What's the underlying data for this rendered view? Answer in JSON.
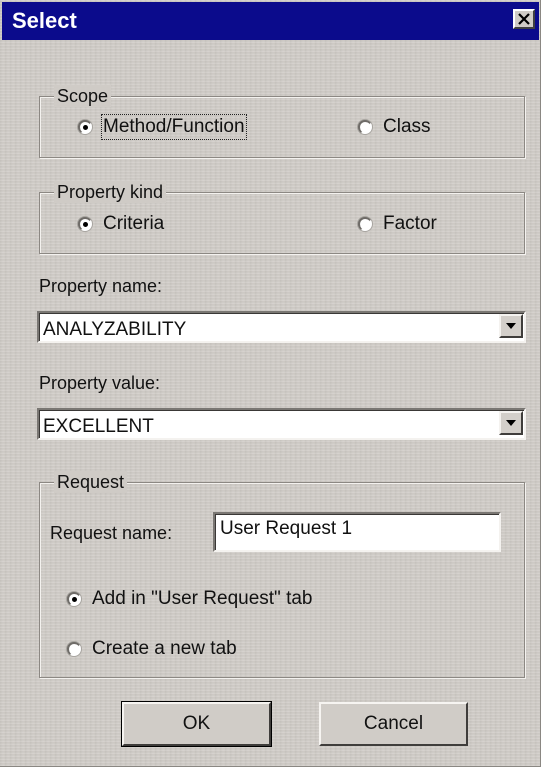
{
  "window": {
    "title": "Select",
    "close_glyph": "✕"
  },
  "scope": {
    "legend": "Scope",
    "options": [
      {
        "label": "Method/Function",
        "selected": true
      },
      {
        "label": "Class",
        "selected": false
      }
    ]
  },
  "property_kind": {
    "legend": "Property kind",
    "options": [
      {
        "label": "Criteria",
        "selected": true
      },
      {
        "label": "Factor",
        "selected": false
      }
    ]
  },
  "property_name": {
    "label": "Property name:",
    "value": "ANALYZABILITY"
  },
  "property_value": {
    "label": "Property value:",
    "value": "EXCELLENT"
  },
  "request": {
    "legend": "Request",
    "name_label": "Request name:",
    "name_value": "User Request 1",
    "options": [
      {
        "label": "Add in \"User Request\" tab",
        "selected": true
      },
      {
        "label": "Create a new tab",
        "selected": false
      }
    ]
  },
  "buttons": {
    "ok": "OK",
    "cancel": "Cancel"
  },
  "colors": {
    "titlebar": "#0b0b8c",
    "dialog_bg": "#cfcbc6"
  },
  "icons": {
    "close": "close-icon",
    "dropdown": "chevron-down-icon",
    "radio_selected": "radio-selected-icon",
    "radio_unselected": "radio-unselected-icon"
  }
}
